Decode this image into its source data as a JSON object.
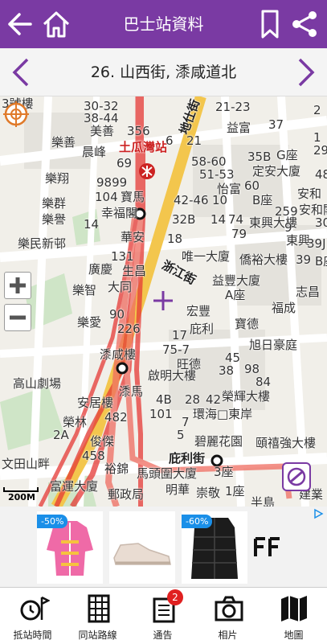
{
  "header": {
    "title": "巴士站資料",
    "bg_color": "#7a3aa3",
    "back_icon": "arrow-left-icon",
    "home_icon": "home-icon",
    "bookmark_icon": "bookmark-icon",
    "share_icon": "share-icon"
  },
  "stop": {
    "name": "26. 山西街, 潻咸道北",
    "prev_icon": "chevron-left-icon",
    "next_icon": "chevron-right-icon"
  },
  "map": {
    "labels": {
      "l1": "30-32",
      "l2": "38-44",
      "l3": "美善",
      "l4": "356",
      "l5": "土瓜灣站",
      "l6": "樂善",
      "l7": "晨峰",
      "l8": "69",
      "l9": "樂翔",
      "l10": "9899",
      "l11": "樂群",
      "l12": "樂譽",
      "l13": "104",
      "l14": "寶馬",
      "l15": "幸福閣",
      "l16": "14",
      "l17": "樂民新邨",
      "l18": "華安",
      "l19": "131",
      "l20": "生昌",
      "l21": "廣慶",
      "l22": "樂智",
      "l23": "大同",
      "l24": "樂愛",
      "l25": "90",
      "l26": "226",
      "l27": "潻咸樓",
      "l28": "高山劇場",
      "l29": "潻馬",
      "l30": "安居樓",
      "l31": "482",
      "l32": "榮林",
      "l33": "2A",
      "l34": "俊傑",
      "l35": "458",
      "l36": "文田山畔",
      "l37": "裕錦",
      "l38": "富運大廈",
      "l39": "郵政局",
      "l40": "馬頭圍大廈",
      "l41": "明華",
      "l42": "崇敬",
      "l43": "1座",
      "l44": "半島",
      "l45": "建業",
      "l46": "庇利街",
      "l47": "3座",
      "l48": "碧麗花園",
      "l49": "頤禧強大樓",
      "l50": "榮輝大樓",
      "l51": "環海□東岸",
      "l52": "28",
      "l53": "42",
      "l54": "4B",
      "l55": "101",
      "l56": "7",
      "l57": "5",
      "l58": "啟明大樓",
      "l59": "旺德",
      "l60": "75-7",
      "l61": "17",
      "l62": "庇利",
      "l63": "宏豐",
      "l64": "寶德",
      "l65": "旭日豪庭",
      "l66": "38",
      "l67": "45",
      "l68": "98",
      "l69": "84",
      "l70": "A座",
      "l71": "益豐大廈",
      "l72": "志昌",
      "l73": "福成",
      "l74": "浙江街",
      "l75": "唯一大廈",
      "l76": "僑裕大樓",
      "l77": "39",
      "l78": "18",
      "l79": "32B",
      "l80": "42-46",
      "l81": "14",
      "l82": "74",
      "l83": "東興大樓",
      "l84": "10",
      "l85": "79",
      "l86": "東興",
      "l87": "51-53",
      "l88": "怡富",
      "l89": "58-60",
      "l90": "60",
      "l91": "6",
      "l92": "21",
      "l93": "地仕街",
      "l94": "益富",
      "l95": "21-23",
      "l96": "37",
      "l97": "35B",
      "l98": "G座",
      "l99": "定安大廈",
      "l100": "B座",
      "l101": "259",
      "l102": "安和",
      "l103": "安和閣",
      "l104": "9",
      "l105": "39J",
      "l106": "1",
      "l107": "2",
      "l108": "3號樓",
      "l109": "B座",
      "l110": "29",
      "l111": "48",
      "l112": "30"
    }
  },
  "map_controls": {
    "zoom_in_icon": "plus-icon",
    "zoom_out_icon": "minus-icon",
    "compass_icon": "locate-icon",
    "scale_label": "200M",
    "center_icon": "crosshair-icon"
  },
  "ad": {
    "items": [
      {
        "discount": "-50%",
        "icon": "kids-coat-product"
      },
      {
        "discount": "",
        "icon": "sneaker-product"
      },
      {
        "discount": "-60%",
        "icon": "puffer-jacket-product"
      }
    ],
    "brand_icon": "brand-logo-icon",
    "adchoice_icon": "ad-choices-icon"
  },
  "tabs": [
    {
      "label": "抵站時間",
      "icon": "clock-flag-icon"
    },
    {
      "label": "同站路線",
      "icon": "route-list-icon"
    },
    {
      "label": "通告",
      "icon": "notice-icon",
      "badge": "2"
    },
    {
      "label": "相片",
      "icon": "camera-icon"
    },
    {
      "label": "地圖",
      "icon": "map-icon"
    }
  ],
  "colors": {
    "accent": "#7a3aa3",
    "route_red": "#e53935",
    "road_yellow": "#f3c64d",
    "badge_red": "#e02020"
  }
}
